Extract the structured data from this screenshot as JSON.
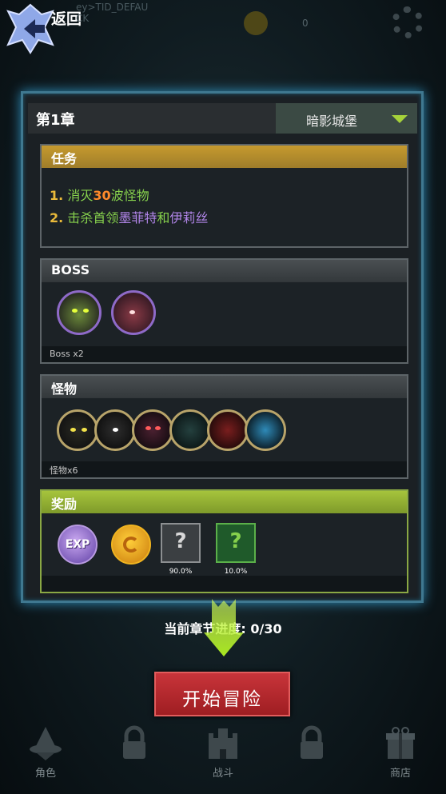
{
  "top": {
    "back_label": "返回",
    "ghost_line1": "ey>TID_DEFAU",
    "ghost_line2": "CK",
    "ghost_count": "0"
  },
  "chapter": {
    "title": "第1章",
    "stage_name": "暗影城堡"
  },
  "mission": {
    "title": "任务",
    "line1": {
      "num": "1.",
      "pre": "消灭",
      "count": "30",
      "post": "波怪物"
    },
    "line2": {
      "num": "2.",
      "pre": "击杀首领",
      "boss1": "墨菲特",
      "and": "和",
      "boss2": "伊莉丝"
    }
  },
  "boss": {
    "title": "BOSS",
    "count_label": "Boss x2",
    "icons": [
      "boss-murphet-icon",
      "boss-iris-icon"
    ]
  },
  "monsters": {
    "title": "怪物",
    "count_label": "怪物x6",
    "icons": [
      "monster-1-icon",
      "monster-2-icon",
      "monster-3-icon",
      "monster-4-icon",
      "monster-5-icon",
      "monster-6-icon"
    ]
  },
  "rewards": {
    "title": "奖励",
    "exp_label": "EXP",
    "items": [
      {
        "symbol": "?",
        "pct": "90.0%"
      },
      {
        "symbol": "?",
        "pct": "10.0%"
      }
    ]
  },
  "progress_text": "当前章节进度: 0/30",
  "start_button": "开始冒险",
  "tabs": [
    {
      "label": "角色",
      "icon": "wizard-hat-icon"
    },
    {
      "label": "",
      "icon": "lock-icon"
    },
    {
      "label": "战斗",
      "icon": "castle-icon"
    },
    {
      "label": "",
      "icon": "lock-icon"
    },
    {
      "label": "商店",
      "icon": "gift-icon"
    }
  ],
  "colors": {
    "accent_green": "#86d04c",
    "accent_purple": "#b286ea",
    "accent_gold": "#e8b93a",
    "start_red": "#c8343a",
    "panel_glow": "#2e8cb8"
  }
}
